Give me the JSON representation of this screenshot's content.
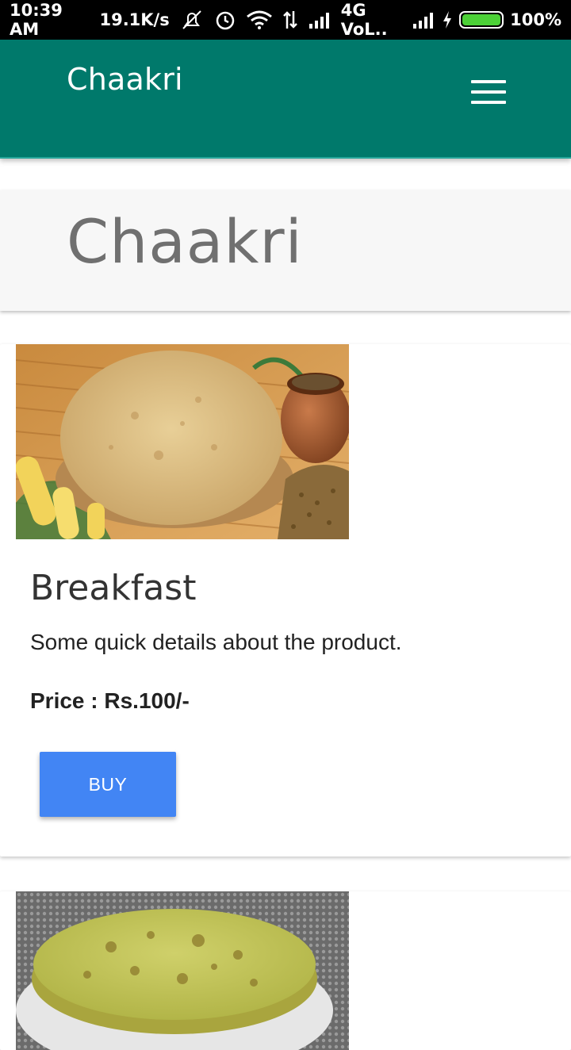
{
  "status_bar": {
    "time": "10:39 AM",
    "speed": "19.1K/s",
    "network": "4G VoL..",
    "battery": "100%"
  },
  "app_bar": {
    "brand": "Chaakri",
    "menu_icon": "hamburger-menu-icon"
  },
  "header": {
    "title": "Chaakri"
  },
  "products": [
    {
      "title": "Breakfast",
      "details": "Some quick details about the product.",
      "price": "Price : Rs.100/-",
      "button_label": "BUY",
      "button_color": "#4285f4"
    }
  ],
  "colors": {
    "app_bar": "#00796b",
    "header_text": "#707070",
    "button": "#4285f4"
  }
}
